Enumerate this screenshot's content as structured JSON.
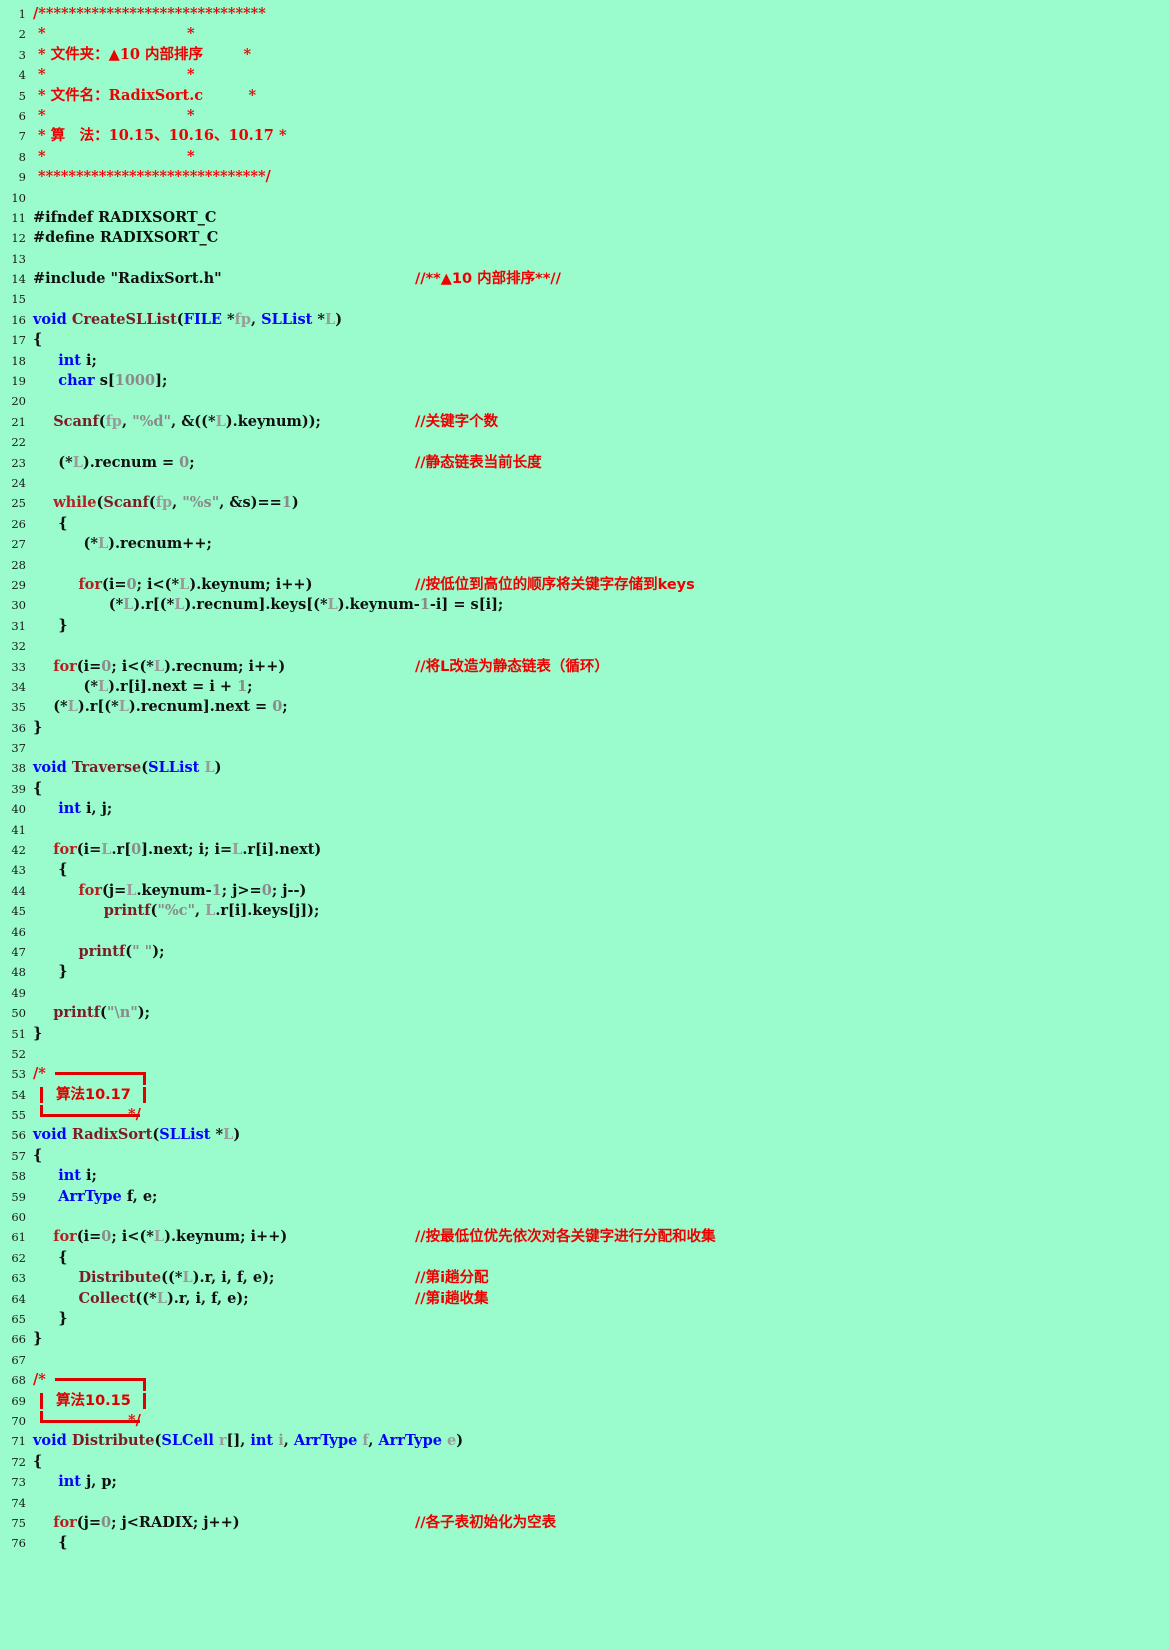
{
  "document": {
    "language": "C",
    "file_name": "RadixSort.c",
    "background_color": "#9afccd",
    "comment_color": "#ee0000",
    "keyword_color": "#0000ff",
    "function_color": "#7b1c26",
    "variable_color": "#9a9a9a",
    "first_line": 1,
    "last_line": 76
  },
  "header_comment": {
    "folder_label": "* 文件夹：▲10 内部排序",
    "file_label": "* 文件名：RadixSort.c",
    "algo_label": "* 算　法：10.15、10.16、10.17 *",
    "star_rule_open": "/******************************",
    "star_rule_close": " ******************************/",
    "star_blank": "*                              *"
  },
  "annotations": [
    {
      "line": 54,
      "label": "算法10.17"
    },
    {
      "line": 69,
      "label": "算法10.15"
    }
  ],
  "side_comments": {
    "l14": "//**▲10 内部排序**//",
    "l21": "//关键字个数",
    "l23": "//静态链表当前长度",
    "l29": "//按低位到高位的顺序将关键字存储到keys",
    "l33": "//将L改造为静态链表（循环）",
    "l61": "//按最低位优先依次对各关键字进行分配和收集",
    "l63": "//第i趟分配",
    "l64": "//第i趟收集",
    "l75": "//各子表初始化为空表"
  },
  "lines": [
    {
      "n": 1,
      "text": "/******************************"
    },
    {
      "n": 2,
      "text": " *                            *"
    },
    {
      "n": 3,
      "text": " * 文件夹：▲10 内部排序        *"
    },
    {
      "n": 4,
      "text": " *                            *"
    },
    {
      "n": 5,
      "text": " * 文件名：RadixSort.c         *"
    },
    {
      "n": 6,
      "text": " *                            *"
    },
    {
      "n": 7,
      "text": " * 算　法：10.15、10.16、10.17 *"
    },
    {
      "n": 8,
      "text": " *                            *"
    },
    {
      "n": 9,
      "text": " ******************************/"
    },
    {
      "n": 10,
      "text": ""
    },
    {
      "n": 11,
      "text": "#ifndef RADIXSORT_C"
    },
    {
      "n": 12,
      "text": "#define RADIXSORT_C"
    },
    {
      "n": 13,
      "text": ""
    },
    {
      "n": 14,
      "text": "#include \"RadixSort.h\""
    },
    {
      "n": 15,
      "text": ""
    },
    {
      "n": 16,
      "text": "void CreateSLList(FILE *fp, SLList *L)"
    },
    {
      "n": 17,
      "text": "{"
    },
    {
      "n": 18,
      "text": "        int i;"
    },
    {
      "n": 19,
      "text": "        char s[1000];"
    },
    {
      "n": 20,
      "text": ""
    },
    {
      "n": 21,
      "text": "        Scanf(fp, \"%d\", &((*L).keynum));"
    },
    {
      "n": 22,
      "text": ""
    },
    {
      "n": 23,
      "text": "        (*L).recnum = 0;"
    },
    {
      "n": 24,
      "text": ""
    },
    {
      "n": 25,
      "text": "        while(Scanf(fp, \"%s\", &s)==1)"
    },
    {
      "n": 26,
      "text": "        {"
    },
    {
      "n": 27,
      "text": "                (*L).recnum++;"
    },
    {
      "n": 28,
      "text": ""
    },
    {
      "n": 29,
      "text": "                for(i=0; i<(*L).keynum; i++)"
    },
    {
      "n": 30,
      "text": "                        (*L).r[(*L).recnum].keys[(*L).keynum-1-i] = s[i];"
    },
    {
      "n": 31,
      "text": "        }"
    },
    {
      "n": 32,
      "text": ""
    },
    {
      "n": 33,
      "text": "        for(i=0; i<(*L).recnum; i++)"
    },
    {
      "n": 34,
      "text": "                (*L).r[i].next = i + 1;"
    },
    {
      "n": 35,
      "text": "        (*L).r[(*L).recnum].next = 0;"
    },
    {
      "n": 36,
      "text": "}"
    },
    {
      "n": 37,
      "text": ""
    },
    {
      "n": 38,
      "text": "void Traverse(SLList L)"
    },
    {
      "n": 39,
      "text": "{"
    },
    {
      "n": 40,
      "text": "        int i, j;"
    },
    {
      "n": 41,
      "text": ""
    },
    {
      "n": 42,
      "text": "        for(i=L.r[0].next; i; i=L.r[i].next)"
    },
    {
      "n": 43,
      "text": "        {"
    },
    {
      "n": 44,
      "text": "                for(j=L.keynum-1; j>=0; j--)"
    },
    {
      "n": 45,
      "text": "                        printf(\"%c\", L.r[i].keys[j]);"
    },
    {
      "n": 46,
      "text": ""
    },
    {
      "n": 47,
      "text": "                printf(\" \");"
    },
    {
      "n": 48,
      "text": "        }"
    },
    {
      "n": 49,
      "text": ""
    },
    {
      "n": 50,
      "text": "        printf(\"\\n\");"
    },
    {
      "n": 51,
      "text": "}"
    },
    {
      "n": 52,
      "text": ""
    },
    {
      "n": 53,
      "text": "/*"
    },
    {
      "n": 54,
      "text": "算法10.17"
    },
    {
      "n": 55,
      "text": "*/"
    },
    {
      "n": 56,
      "text": "void RadixSort(SLList *L)"
    },
    {
      "n": 57,
      "text": "{"
    },
    {
      "n": 58,
      "text": "        int i;"
    },
    {
      "n": 59,
      "text": "        ArrType f, e;"
    },
    {
      "n": 60,
      "text": ""
    },
    {
      "n": 61,
      "text": "        for(i=0; i<(*L).keynum; i++)"
    },
    {
      "n": 62,
      "text": "        {"
    },
    {
      "n": 63,
      "text": "                Distribute((*L).r, i, f, e);"
    },
    {
      "n": 64,
      "text": "                Collect((*L).r, i, f, e);"
    },
    {
      "n": 65,
      "text": "        }"
    },
    {
      "n": 66,
      "text": "}"
    },
    {
      "n": 67,
      "text": ""
    },
    {
      "n": 68,
      "text": "/*"
    },
    {
      "n": 69,
      "text": "算法10.15"
    },
    {
      "n": 70,
      "text": "*/"
    },
    {
      "n": 71,
      "text": "void Distribute(SLCell r[], int i, ArrType f, ArrType e)"
    },
    {
      "n": 72,
      "text": "{"
    },
    {
      "n": 73,
      "text": "        int j, p;"
    },
    {
      "n": 74,
      "text": ""
    },
    {
      "n": 75,
      "text": "        for(j=0; j<RADIX; j++)"
    },
    {
      "n": 76,
      "text": "        {"
    }
  ]
}
